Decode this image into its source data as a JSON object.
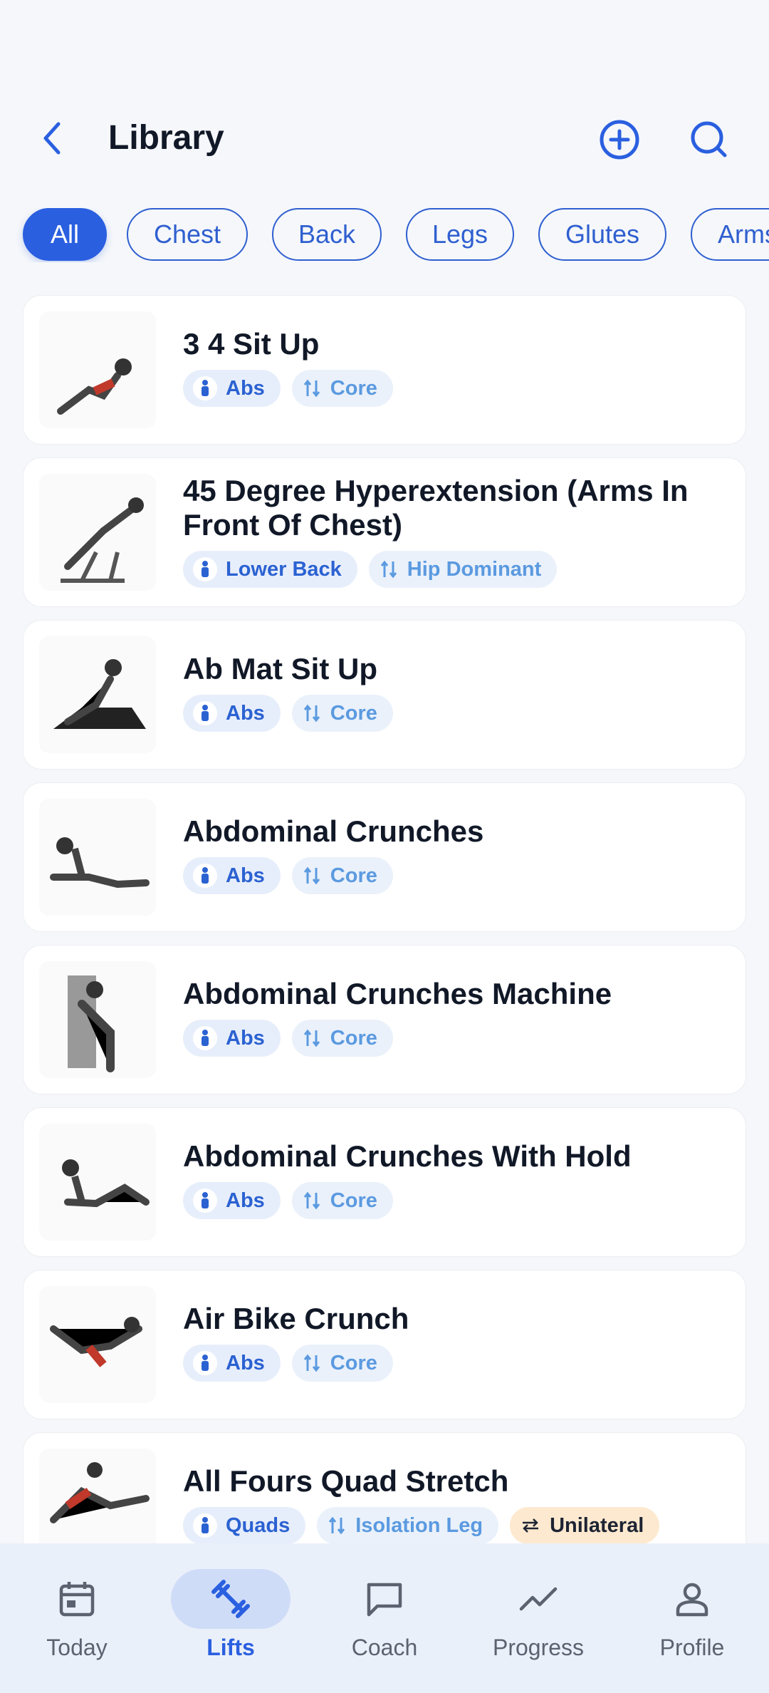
{
  "header": {
    "title": "Library"
  },
  "filters": [
    "All",
    "Chest",
    "Back",
    "Legs",
    "Glutes",
    "Arms"
  ],
  "exercises": [
    {
      "name": "3 4 Sit Up",
      "tags": [
        {
          "kind": "muscle",
          "label": "Abs"
        },
        {
          "kind": "pattern",
          "label": "Core"
        }
      ]
    },
    {
      "name": "45 Degree Hyperextension (Arms In Front Of Chest)",
      "tags": [
        {
          "kind": "muscle",
          "label": "Lower Back"
        },
        {
          "kind": "pattern",
          "label": "Hip Dominant"
        }
      ]
    },
    {
      "name": "Ab Mat Sit Up",
      "tags": [
        {
          "kind": "muscle",
          "label": "Abs"
        },
        {
          "kind": "pattern",
          "label": "Core"
        }
      ]
    },
    {
      "name": "Abdominal Crunches",
      "tags": [
        {
          "kind": "muscle",
          "label": "Abs"
        },
        {
          "kind": "pattern",
          "label": "Core"
        }
      ]
    },
    {
      "name": "Abdominal Crunches Machine",
      "tags": [
        {
          "kind": "muscle",
          "label": "Abs"
        },
        {
          "kind": "pattern",
          "label": "Core"
        }
      ]
    },
    {
      "name": "Abdominal Crunches With Hold",
      "tags": [
        {
          "kind": "muscle",
          "label": "Abs"
        },
        {
          "kind": "pattern",
          "label": "Core"
        }
      ]
    },
    {
      "name": "Air Bike Crunch",
      "tags": [
        {
          "kind": "muscle",
          "label": "Abs"
        },
        {
          "kind": "pattern",
          "label": "Core"
        }
      ]
    },
    {
      "name": "All Fours Quad Stretch",
      "tags": [
        {
          "kind": "muscle",
          "label": "Quads"
        },
        {
          "kind": "pattern",
          "label": "Isolation Leg"
        },
        {
          "kind": "uni",
          "label": "Unilateral"
        }
      ]
    }
  ],
  "nav": [
    {
      "label": "Today",
      "icon": "calendar-icon"
    },
    {
      "label": "Lifts",
      "icon": "dumbbell-icon",
      "active": true
    },
    {
      "label": "Coach",
      "icon": "chat-icon"
    },
    {
      "label": "Progress",
      "icon": "trend-icon"
    },
    {
      "label": "Profile",
      "icon": "person-icon"
    }
  ],
  "colors": {
    "accent": "#2a5fe0",
    "tag_muscle": "#2b62d2",
    "tag_pattern": "#5b9ae0",
    "unilateral_bg": "#fde9cf"
  }
}
